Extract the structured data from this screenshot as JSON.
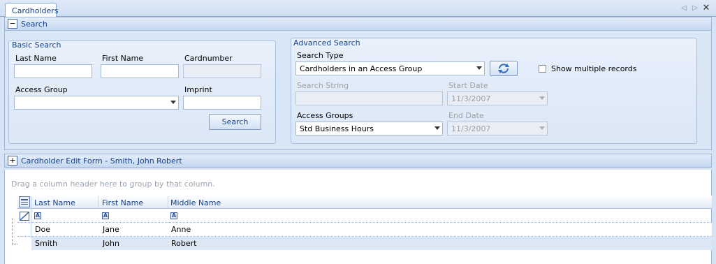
{
  "tabs": {
    "active_label": "Cardholders",
    "nav_left_icon": "◁",
    "nav_right_icon": "▷",
    "close_icon": "✕"
  },
  "search": {
    "header_label": "Search",
    "toggle_symbol": "−",
    "basic": {
      "legend": "Basic Search",
      "last_name_label": "Last Name",
      "first_name_label": "First Name",
      "cardnumber_label": "Cardnumber",
      "access_group_label": "Access Group",
      "imprint_label": "Imprint",
      "last_name_value": "",
      "first_name_value": "",
      "cardnumber_value": "",
      "access_group_value": "",
      "imprint_value": "",
      "search_button": "Search"
    },
    "advanced": {
      "legend": "Advanced Search",
      "search_type_label": "Search Type",
      "search_type_value": "Cardholders in an Access Group",
      "show_multiple_label": "Show multiple records",
      "search_string_label": "Search String",
      "start_date_label": "Start Date",
      "start_date_value": "11/3/2007",
      "access_groups_label": "Access Groups",
      "access_groups_value": "Std Business Hours",
      "end_date_label": "End Date",
      "end_date_value": "11/3/2007"
    }
  },
  "edit_form": {
    "toggle_symbol": "+",
    "header_label": "Cardholder Edit Form - Smith, John Robert"
  },
  "grid": {
    "group_hint": "Drag a column header here to group by that column.",
    "columns": [
      "Last Name",
      "First Name",
      "Middle Name"
    ],
    "filter_symbol": "A",
    "rows": [
      {
        "last": "Doe",
        "first": "Jane",
        "middle": "Anne"
      },
      {
        "last": "Smith",
        "first": "John",
        "middle": "Robert"
      }
    ],
    "selected_row_color": "#dce7f5"
  }
}
